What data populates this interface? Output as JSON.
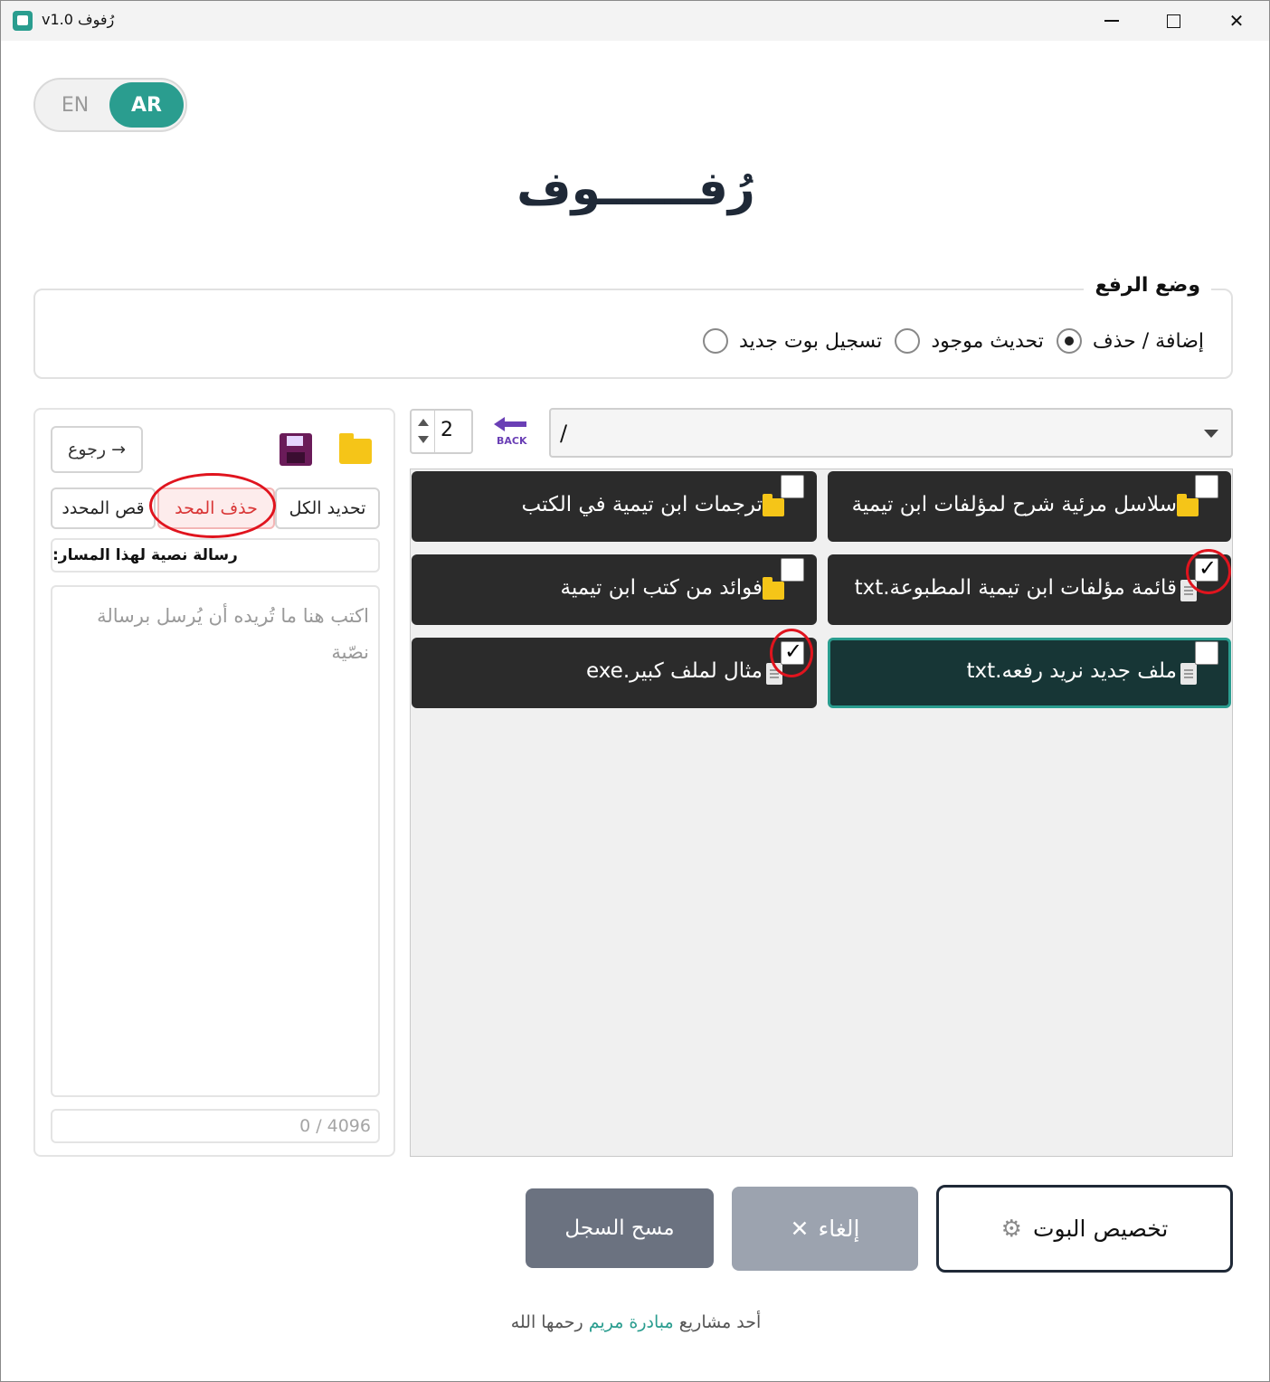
{
  "window": {
    "title": "v1.0 رُفوف",
    "controls": {
      "minimize": "minimize-icon",
      "maximize": "maximize-icon",
      "close": "close-icon"
    }
  },
  "language": {
    "en": "EN",
    "ar": "AR",
    "active": "AR"
  },
  "header": {
    "title": "رُفــــــوف"
  },
  "upload_mode": {
    "legend": "وضع الرفع",
    "options": [
      {
        "label": "تسجيل بوت جديد",
        "checked": false
      },
      {
        "label": "تحديث موجود",
        "checked": false
      },
      {
        "label": "إضافة / حذف",
        "checked": true
      }
    ]
  },
  "side_panel": {
    "back_label": "→ رجوع",
    "select_all_label": "تحديد الكل",
    "delete_label": "حذف المحد",
    "cut_label": "قص المحدد",
    "message_label": "رسالة نصية لهذا المسار:",
    "message_placeholder": "اكتب هنا ما تُريده أن يُرسل برسالة نصّية",
    "counter": "0 / 4096",
    "icons": {
      "save": "save-icon",
      "folder": "folder-icon"
    }
  },
  "toolbar": {
    "spin_value": "2",
    "back_icon_text": "BACK",
    "path_value": "/"
  },
  "items": [
    {
      "label": "سلاسل مرئية شرح لمؤلفات ابن تيمية",
      "type": "folder",
      "checked": false,
      "active": false
    },
    {
      "label": "ترجمات ابن تيمية في الكتب",
      "type": "folder",
      "checked": false,
      "active": false
    },
    {
      "label": "قائمة مؤلفات ابن تيمية المطبوعة.txt",
      "type": "file",
      "checked": true,
      "active": false
    },
    {
      "label": "فوائد من كتب ابن تيمية",
      "type": "folder",
      "checked": false,
      "active": false
    },
    {
      "label": "ملف جديد نريد رفعه.txt",
      "type": "file",
      "checked": false,
      "active": true
    },
    {
      "label": "مثال لملف كبير.exe",
      "type": "file",
      "checked": true,
      "active": false
    }
  ],
  "buttons": {
    "clear_log": "مسح السجل",
    "cancel": "إلغاء",
    "cancel_icon": "✕",
    "customize": "تخصيص البوت",
    "customize_icon": "⚙"
  },
  "footer": {
    "prefix": "أحد مشاريع",
    "link": "مبادرة مريم",
    "suffix": "رحمها الله"
  },
  "colors": {
    "accent": "#2a9d8f",
    "card_bg": "#2b2b2b",
    "card_active_bg": "#173636",
    "folder": "#f5c518",
    "delete_text": "#d93636",
    "annotation": "#e0141e"
  }
}
